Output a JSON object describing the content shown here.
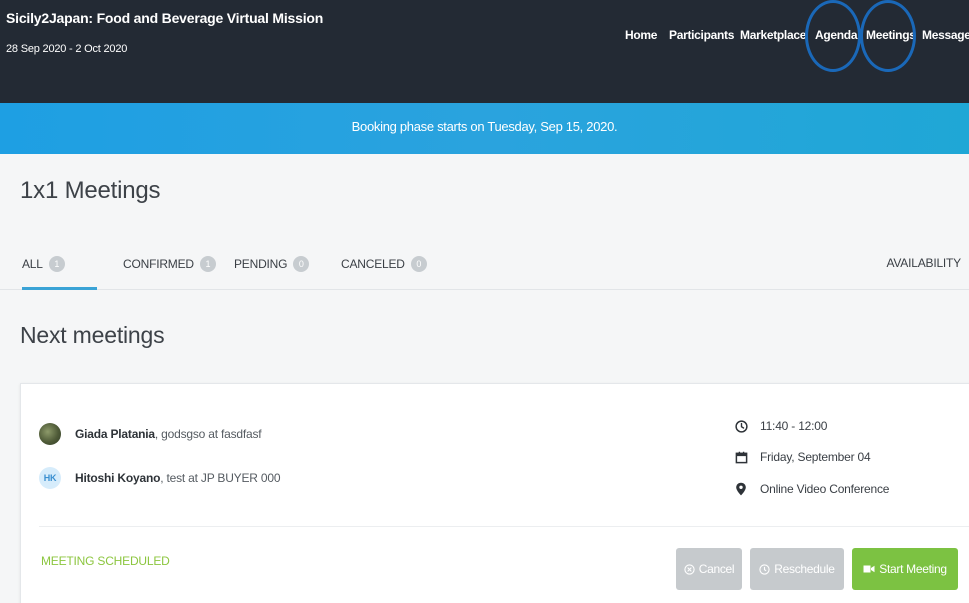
{
  "event": {
    "title": "Sicily2Japan: Food and Beverage Virtual Mission",
    "dates": "28 Sep 2020 - 2 Oct 2020"
  },
  "nav": {
    "home": "Home",
    "participants": "Participants",
    "marketplace": "Marketplace",
    "agenda": "Agenda",
    "meetings": "Meetings",
    "messages": "Messages"
  },
  "banner": {
    "text": "Booking phase starts on Tuesday, Sep 15, 2020."
  },
  "page": {
    "title": "1x1 Meetings"
  },
  "tabs": {
    "all": {
      "label": "ALL",
      "count": "1"
    },
    "confirmed": {
      "label": "CONFIRMED",
      "count": "1"
    },
    "pending": {
      "label": "PENDING",
      "count": "0"
    },
    "canceled": {
      "label": "CANCELED",
      "count": "0"
    },
    "availability": "AVAILABILITY"
  },
  "section": {
    "title": "Next meetings"
  },
  "meeting": {
    "participants": [
      {
        "name": "Giada Platania",
        "rest": ", godsgso at fasdfasf"
      },
      {
        "name": "Hitoshi Koyano",
        "rest": ", test at JP BUYER 000",
        "initials": "HK"
      }
    ],
    "time": "11:40 - 12:00",
    "date": "Friday, September 04",
    "location": "Online Video Conference",
    "status": "MEETING SCHEDULED",
    "buttons": {
      "cancel": "Cancel",
      "reschedule": "Reschedule",
      "start": "Start Meeting"
    }
  },
  "colors": {
    "header_bg": "#232a34",
    "banner": "#1e9fe3",
    "accent_green": "#7cc242",
    "highlight_circle": "#1a68b8"
  }
}
